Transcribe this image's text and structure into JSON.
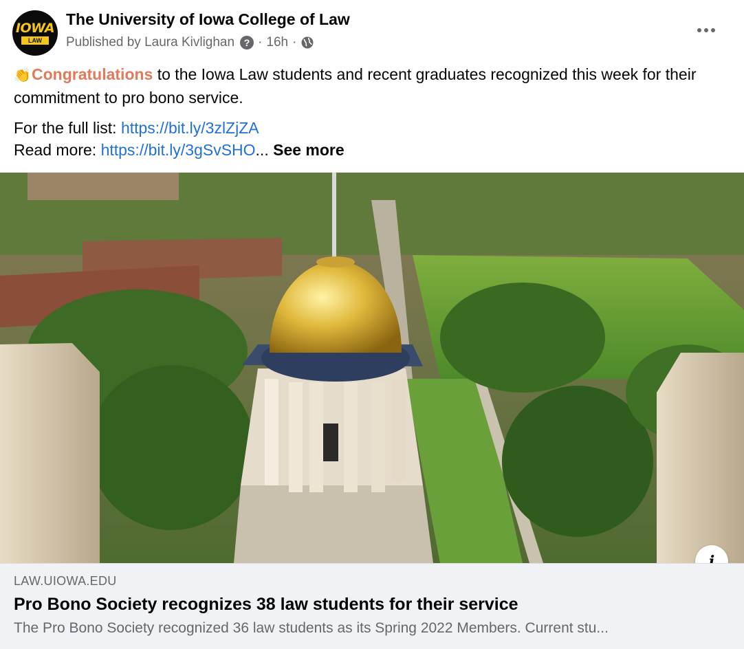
{
  "header": {
    "logo_text": "IOWA",
    "logo_subtext": "LAW",
    "page_name": "The University of Iowa College of Law",
    "published_by": "Published by Laura Kivlighan",
    "time": "16h",
    "audience_icon": "globe-icon",
    "info_icon": "question-icon",
    "more_icon": "more-horizontal-icon"
  },
  "post": {
    "emoji": "👏",
    "highlight": "Congratulations",
    "line1_rest": " to the Iowa Law students and recent graduates recognized this week for their commitment to pro bono service.",
    "full_list_label": "For the full list: ",
    "full_list_link": "https://bit.ly/3zlZjZA",
    "read_more_label": "Read more: ",
    "read_more_link": "https://bit.ly/3gSvSHO",
    "ellipsis": "...",
    "see_more": "See more"
  },
  "link_preview": {
    "domain": "LAW.UIOWA.EDU",
    "title": "Pro Bono Society recognizes 38 law students for their service",
    "description": "The Pro Bono Society recognized 36 law students as its Spring 2022 Members. Current stu...",
    "info_icon": "info-icon"
  },
  "colors": {
    "highlight": "#e07a5a",
    "link": "#216fdb",
    "secondary_text": "#65676b",
    "preview_bg": "#f0f2f5",
    "logo_gold": "#f5c518"
  }
}
